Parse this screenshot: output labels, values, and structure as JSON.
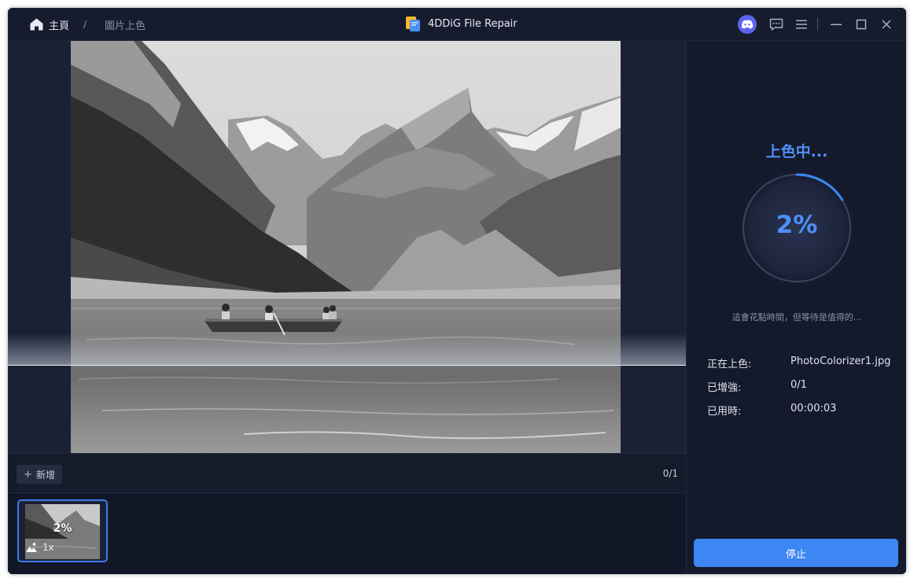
{
  "breadcrumb": {
    "home_icon": "home-icon",
    "home_label": "主頁",
    "separator": "/",
    "current_page": "圖片上色"
  },
  "app": {
    "logo_icon": "app-logo-icon",
    "title": "4DDiG File Repair"
  },
  "title_bar_icons": [
    "discord-icon",
    "feedback-icon",
    "menu-icon",
    "minimize-icon",
    "maximize-icon",
    "close-icon"
  ],
  "preview": {
    "image": "black-and-white mountain lake photo with rowing boat"
  },
  "file_bar": {
    "add_button_label": "新增",
    "add_icon": "plus-icon",
    "count": "0/1"
  },
  "thumbnail": {
    "progress_label": "2%",
    "mode_icon": "image-mode-icon",
    "scale_label": "1x"
  },
  "status": {
    "title": "上色中...",
    "progress_label": "2%",
    "progress": 0.02,
    "note": "這會花點時間，但等待是值得的..."
  },
  "info": {
    "rows": [
      {
        "label": "正在上色:",
        "value": "PhotoColorizer1.jpg"
      },
      {
        "label": "已增強:",
        "value": "0/1"
      },
      {
        "label": "已用時:",
        "value": "00:00:03"
      }
    ]
  },
  "actions": {
    "stop_label": "停止"
  },
  "colors": {
    "window_bg": "#121728",
    "panel_bg": "#141a2c",
    "accent": "#3d86f3",
    "accent_text": "#4f8ff7",
    "discord": "#5b63f0"
  }
}
